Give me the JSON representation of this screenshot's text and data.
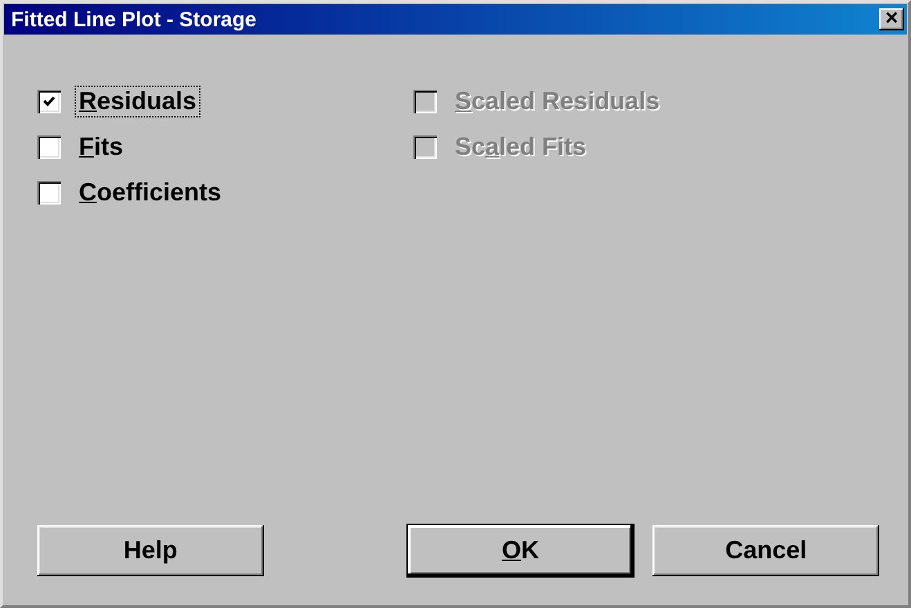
{
  "window": {
    "title": "Fitted Line Plot - Storage",
    "close": "×"
  },
  "left_options": [
    {
      "label_parts": [
        {
          "text": "R",
          "underlined": true
        },
        {
          "text": "esiduals",
          "underlined": false
        }
      ],
      "checked": true,
      "disabled": false,
      "focused": true
    },
    {
      "label_parts": [
        {
          "text": "F",
          "underlined": true
        },
        {
          "text": "its",
          "underlined": false
        }
      ],
      "checked": false,
      "disabled": false,
      "focused": false
    },
    {
      "label_parts": [
        {
          "text": "C",
          "underlined": true
        },
        {
          "text": "oefficients",
          "underlined": false
        }
      ],
      "checked": false,
      "disabled": false,
      "focused": false
    }
  ],
  "right_options": [
    {
      "label_parts": [
        {
          "text": "S",
          "underlined": true
        },
        {
          "text": "caled Residuals",
          "underlined": false
        }
      ],
      "checked": false,
      "disabled": true,
      "focused": false
    },
    {
      "label_parts": [
        {
          "text": "Sc",
          "underlined": false
        },
        {
          "text": "a",
          "underlined": true
        },
        {
          "text": "led Fits",
          "underlined": false
        }
      ],
      "checked": false,
      "disabled": true,
      "focused": false
    }
  ],
  "buttons": [
    {
      "label_parts": [
        {
          "text": "Help",
          "underlined": false
        }
      ],
      "default": false
    },
    {
      "label_parts": [
        {
          "text": "O",
          "underlined": true
        },
        {
          "text": "K",
          "underlined": false
        }
      ],
      "default": true
    },
    {
      "label_parts": [
        {
          "text": "Cancel",
          "underlined": false
        }
      ],
      "default": false
    }
  ]
}
